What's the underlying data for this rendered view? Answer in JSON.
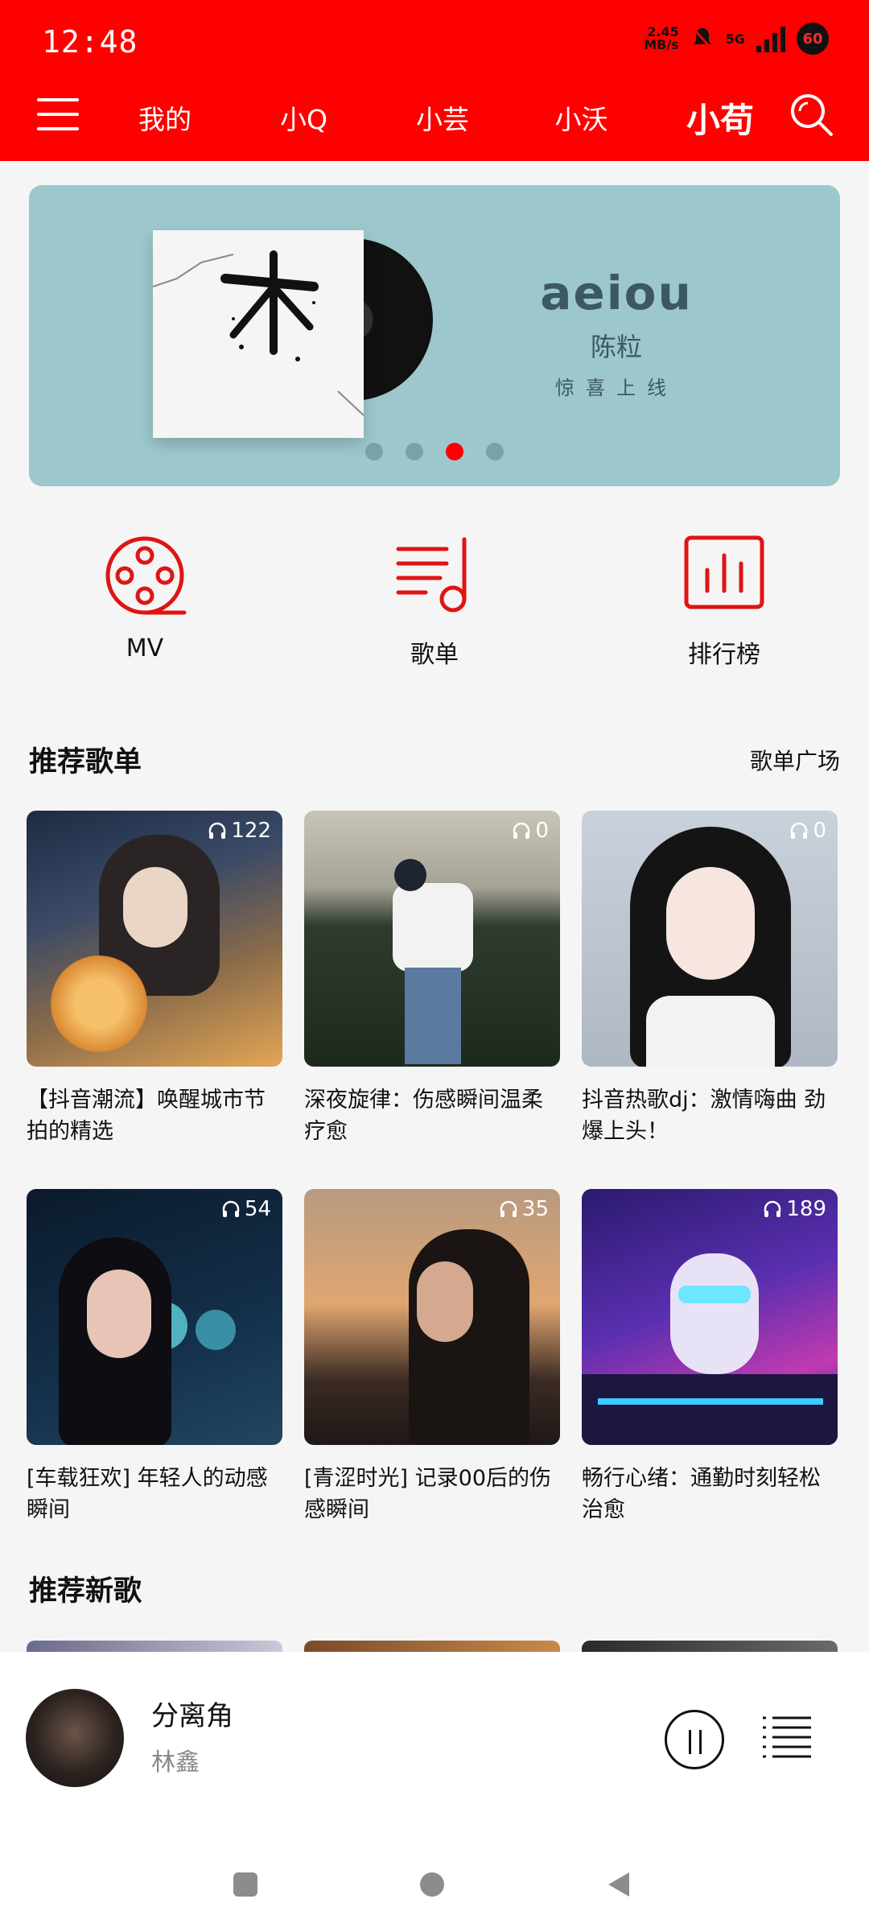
{
  "status": {
    "time": "12:48",
    "speed_value": "2.45",
    "speed_unit": "MB/s",
    "network": "5G",
    "battery": "60"
  },
  "nav": {
    "tabs": [
      "我的",
      "小Q",
      "小芸",
      "小沃",
      "小苟"
    ],
    "active_index": 4
  },
  "banner": {
    "title": "aeiou",
    "artist": "陈粒",
    "tagline": "惊喜上线",
    "active_dot": 2,
    "dot_count": 4
  },
  "quick": [
    {
      "label": "MV",
      "icon": "film-reel-icon"
    },
    {
      "label": "歌单",
      "icon": "playlist-note-icon"
    },
    {
      "label": "排行榜",
      "icon": "bar-chart-icon"
    }
  ],
  "recommend_playlists": {
    "title": "推荐歌单",
    "link": "歌单广场",
    "items": [
      {
        "caption": "【抖音潮流】唤醒城市节拍的精选",
        "plays": "122"
      },
      {
        "caption": "深夜旋律：伤感瞬间温柔疗愈",
        "plays": "0"
      },
      {
        "caption": "抖音热歌dj：激情嗨曲 劲爆上头！",
        "plays": "0"
      },
      {
        "caption": "[车载狂欢] 年轻人的动感瞬间",
        "plays": "54"
      },
      {
        "caption": "[青涩时光] 记录00后的伤感瞬间",
        "plays": "35"
      },
      {
        "caption": "畅行心绪：通勤时刻轻松治愈",
        "plays": "189"
      }
    ]
  },
  "new_songs": {
    "title": "推荐新歌"
  },
  "player": {
    "song": "分离角",
    "artist": "林鑫"
  },
  "colors": {
    "brand": "#ff0000",
    "banner_bg": "#9cc8cd"
  }
}
